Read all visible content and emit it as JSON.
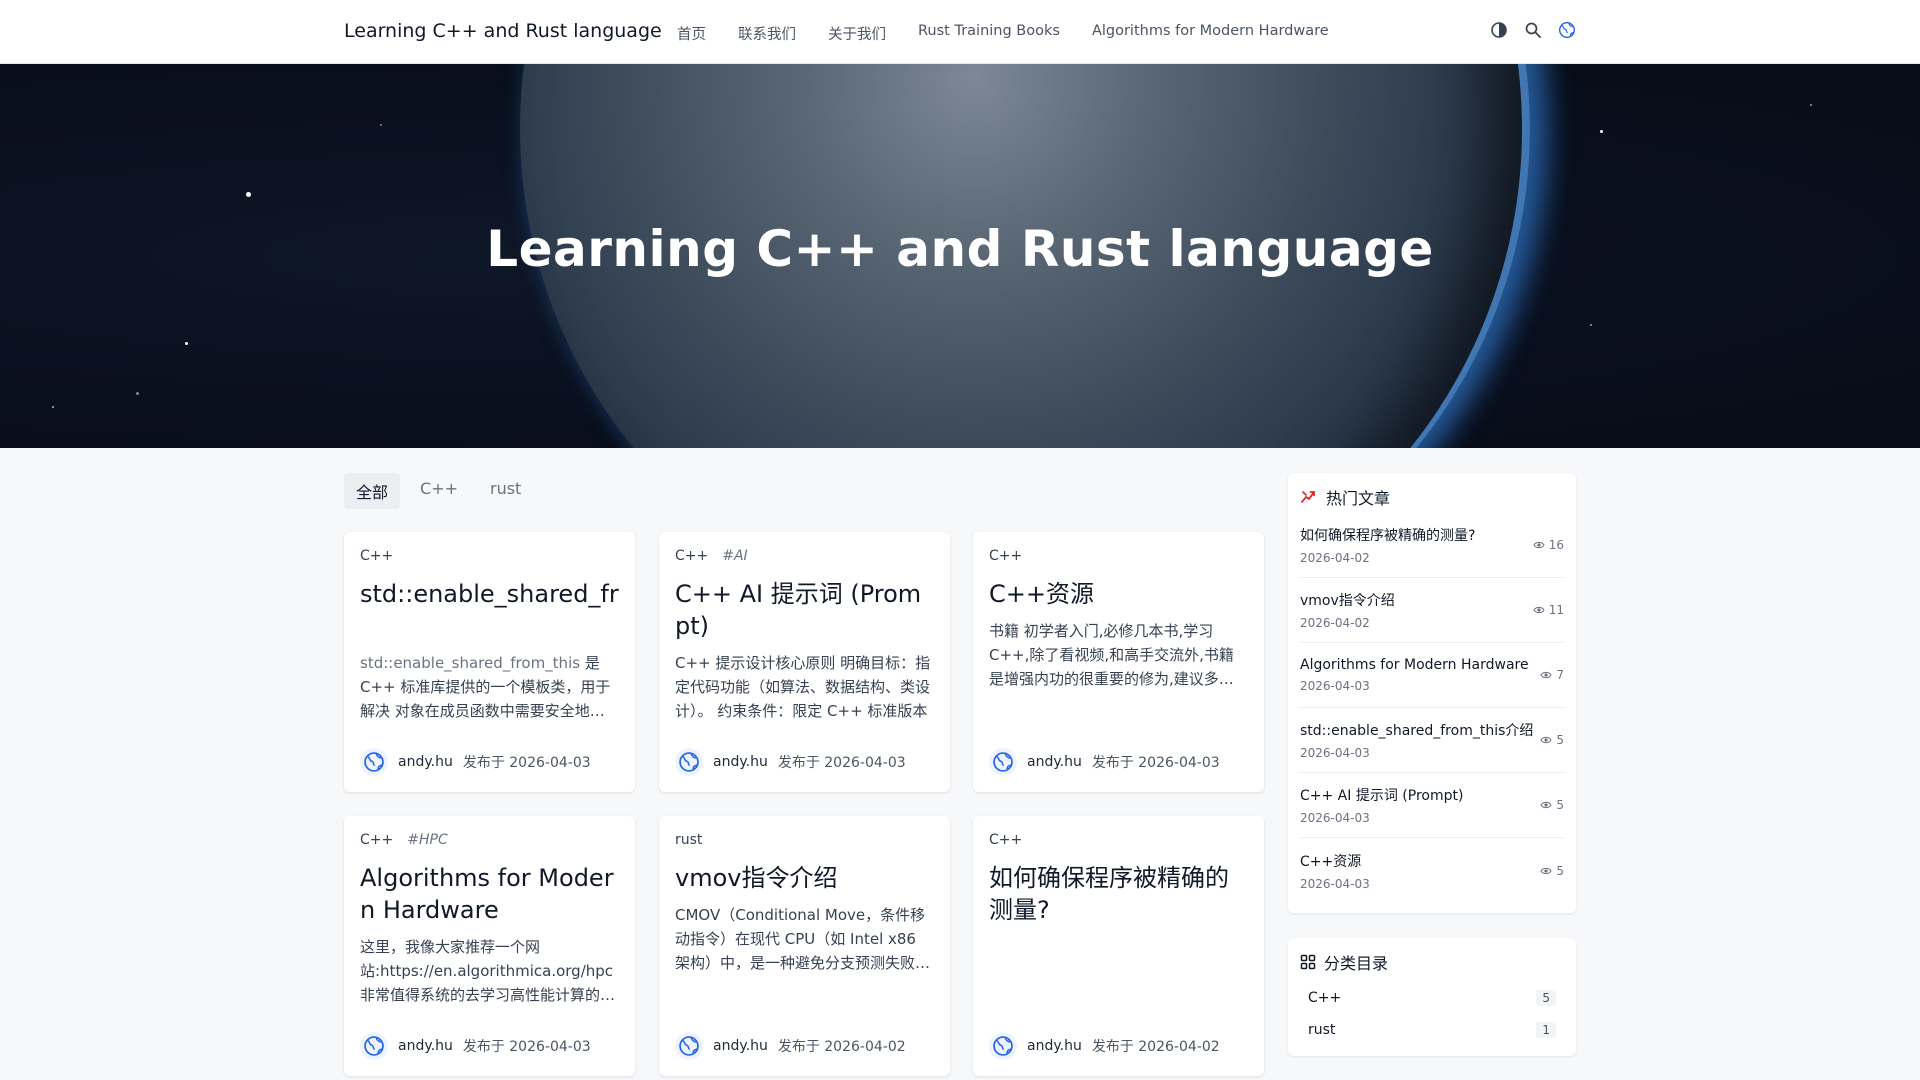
{
  "header": {
    "brand": "Learning C++ and Rust language",
    "nav": [
      "首页",
      "联系我们",
      "关于我们",
      "Rust Training Books",
      "Algorithms for Modern Hardware"
    ],
    "icons": [
      "theme-toggle-icon",
      "search-icon",
      "language-globe-icon"
    ]
  },
  "hero": {
    "title": "Learning C++ and Rust language"
  },
  "filters": [
    "全部",
    "C++",
    "rust"
  ],
  "cards": [
    {
      "category": "C++",
      "tag": "",
      "title": "std::enable_shared_from_this介绍",
      "excerpt_code": "std::enable_shared_from_this",
      "excerpt": " 是 C++ 标准库提供的一个模板类，用于解决 对象在成员函数中需要安全地获取指向自身的 shared_ptr 的问题",
      "author": "andy.hu",
      "date": "发布于 2026-04-03"
    },
    {
      "category": "C++",
      "tag": "#AI",
      "title": "C++ AI 提示词 (Prompt)",
      "excerpt_code": "",
      "excerpt": "C++ 提示设计核心原则 明确目标：指定代码功能（如算法、数据结构、类设计）。 约束条件：限定 C++ 标准版本",
      "author": "andy.hu",
      "date": "发布于 2026-04-03"
    },
    {
      "category": "C++",
      "tag": "",
      "title": "C++资源",
      "excerpt_code": "",
      "excerpt": "书籍 初学者入门,必修几本书,学习C++,除了看视频,和高手交流外,书籍是增强内功的很重要的修为,建议多读书",
      "author": "andy.hu",
      "date": "发布于 2026-04-03"
    },
    {
      "category": "C++",
      "tag": "#HPC",
      "title": "Algorithms for Modern Hardware",
      "excerpt_code": "",
      "excerpt": "这里，我像大家推荐一个网站:https://en.algorithmica.org/hpc 非常值得系统的去学习高性能计算的知识",
      "author": "andy.hu",
      "date": "发布于 2026-04-03"
    },
    {
      "category": "rust",
      "tag": "",
      "title": "vmov指令介绍",
      "excerpt_code": "",
      "excerpt": "CMOV（Conditional Move，条件移动指令）在现代 CPU（如 Intel x86 架构）中，是一种避免分支预测失败的指令",
      "author": "andy.hu",
      "date": "发布于 2026-04-02"
    },
    {
      "category": "C++",
      "tag": "",
      "title": "如何确保程序被精确的测量?",
      "excerpt_code": "",
      "excerpt": "",
      "author": "andy.hu",
      "date": "发布于 2026-04-02"
    }
  ],
  "sidebar": {
    "hot_title": "热门文章",
    "hot": [
      {
        "title": "如何确保程序被精确的测量?",
        "date": "2026-04-02",
        "views": "16"
      },
      {
        "title": "vmov指令介绍",
        "date": "2026-04-02",
        "views": "11"
      },
      {
        "title": "Algorithms for Modern Hardware",
        "date": "2026-04-03",
        "views": "7"
      },
      {
        "title": "std::enable_shared_from_this介绍",
        "date": "2026-04-03",
        "views": "5"
      },
      {
        "title": "C++ AI 提示词 (Prompt)",
        "date": "2026-04-03",
        "views": "5"
      },
      {
        "title": "C++资源",
        "date": "2026-04-03",
        "views": "5"
      }
    ],
    "cat_title": "分类目录",
    "categories": [
      {
        "name": "C++",
        "count": "5"
      },
      {
        "name": "rust",
        "count": "1"
      }
    ]
  }
}
